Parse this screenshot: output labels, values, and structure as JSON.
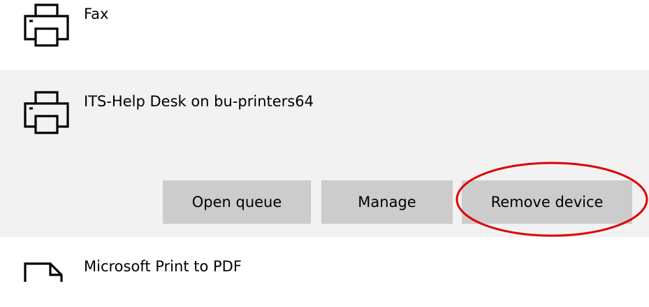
{
  "printers": [
    {
      "name": "Fax",
      "icon": "printer-icon"
    },
    {
      "name": "ITS-Help Desk on bu-printers64",
      "icon": "printer-icon",
      "selected": true
    },
    {
      "name": "Microsoft Print to PDF",
      "icon": "pdf-printer-icon"
    }
  ],
  "actions": {
    "open_queue": "Open queue",
    "manage": "Manage",
    "remove_device": "Remove device"
  },
  "annotation": {
    "shape": "ellipse",
    "target": "remove-device-button",
    "color": "#e00000"
  },
  "colors": {
    "selected_row_bg": "#f2f2f2",
    "button_bg": "#cccccc",
    "text": "#000000"
  }
}
